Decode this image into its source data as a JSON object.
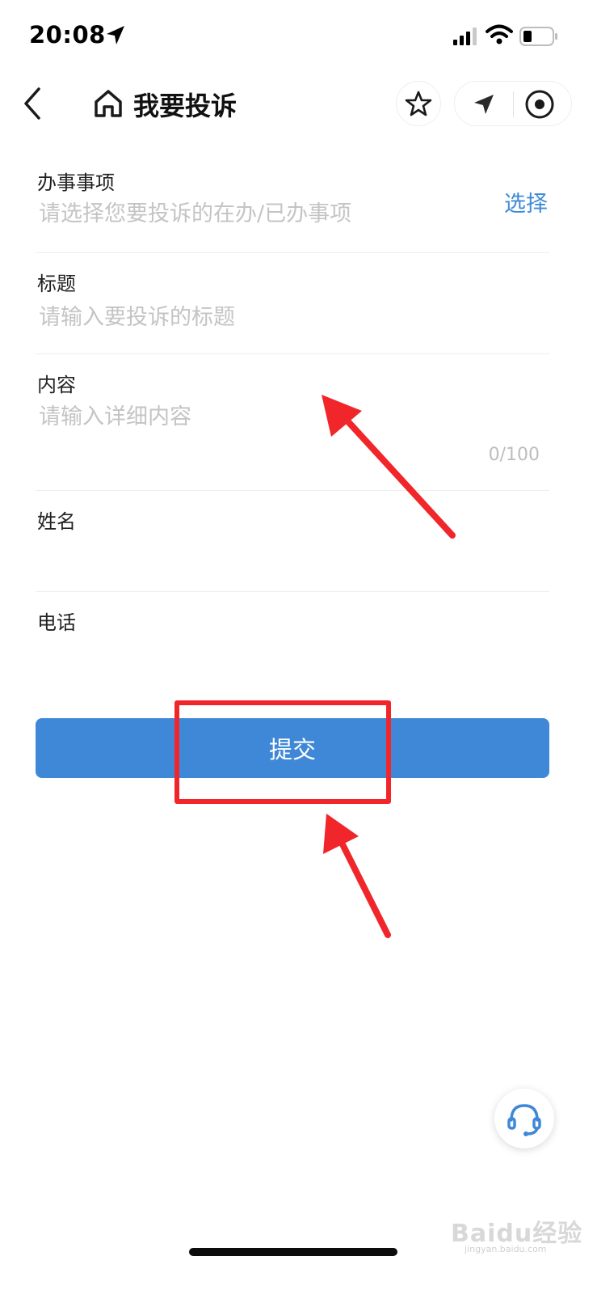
{
  "status_bar": {
    "time": "20:08"
  },
  "nav": {
    "title": "我要投诉"
  },
  "form": {
    "matter": {
      "label": "办事事项",
      "placeholder": "请选择您要投诉的在办/已办事项",
      "action": "选择"
    },
    "title": {
      "label": "标题",
      "placeholder": "请输入要投诉的标题"
    },
    "content": {
      "label": "内容",
      "placeholder": "请输入详细内容",
      "counter": "0/100"
    },
    "name": {
      "label": "姓名",
      "value": ""
    },
    "phone": {
      "label": "电话",
      "value": ""
    }
  },
  "submit_label": "提交",
  "watermark": {
    "brand": "Baidu经验",
    "url": "jingyan.baidu.com"
  },
  "colors": {
    "accent": "#3f88d8",
    "annotation": "#f0262a"
  },
  "icons": [
    "location-arrow-icon",
    "signal-icon",
    "wifi-icon",
    "battery-icon",
    "back-icon",
    "home-icon",
    "star-icon",
    "send-icon",
    "record-icon",
    "headset-icon"
  ]
}
